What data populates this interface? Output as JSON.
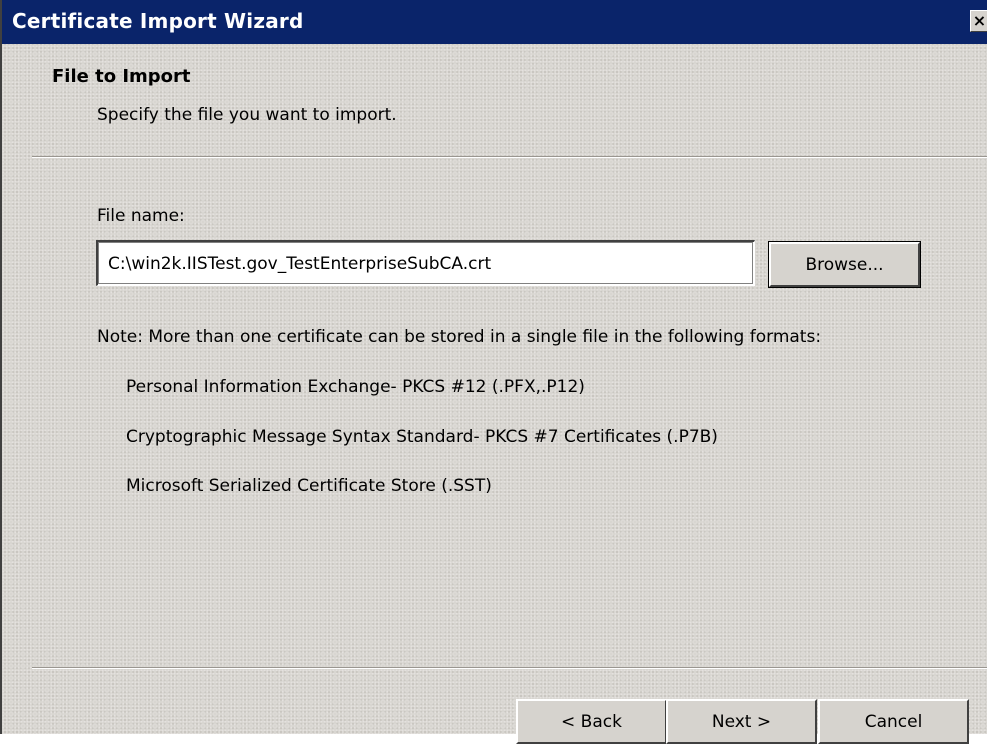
{
  "window": {
    "title": "Certificate Import Wizard",
    "close_glyph": "×"
  },
  "header": {
    "title": "File to Import",
    "subtitle": "Specify the file you want to import."
  },
  "form": {
    "file_name_label": "File name:",
    "file_name_value": "C:\\win2k.IISTest.gov_TestEnterpriseSubCA.crt",
    "browse_label": "Browse..."
  },
  "note": {
    "text": "Note:  More than one certificate can be stored in a single file in the following formats:",
    "formats": [
      "Personal Information Exchange- PKCS #12 (.PFX,.P12)",
      "Cryptographic Message Syntax Standard- PKCS #7 Certificates (.P7B)",
      "Microsoft Serialized Certificate Store (.SST)"
    ]
  },
  "footer": {
    "back_label": "< Back",
    "next_label": "Next >",
    "cancel_label": "Cancel"
  }
}
